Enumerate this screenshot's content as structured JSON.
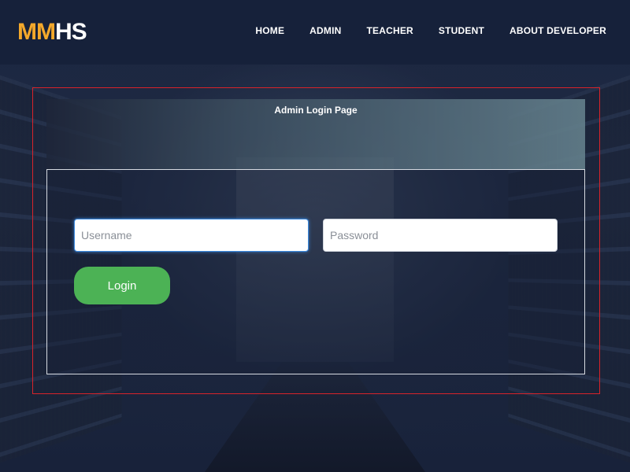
{
  "brand": {
    "part1": "MM",
    "part2": "HS",
    "accent_color": "#f3a82b"
  },
  "nav": {
    "items": [
      {
        "label": "HOME"
      },
      {
        "label": "ADMIN"
      },
      {
        "label": "TEACHER"
      },
      {
        "label": "STUDENT"
      },
      {
        "label": "ABOUT DEVELOPER"
      }
    ]
  },
  "login": {
    "title": "Admin Login Page",
    "username_placeholder": "Username",
    "password_placeholder": "Password",
    "button_label": "Login",
    "button_color": "#4cb255",
    "frame_color": "#d8232a"
  }
}
